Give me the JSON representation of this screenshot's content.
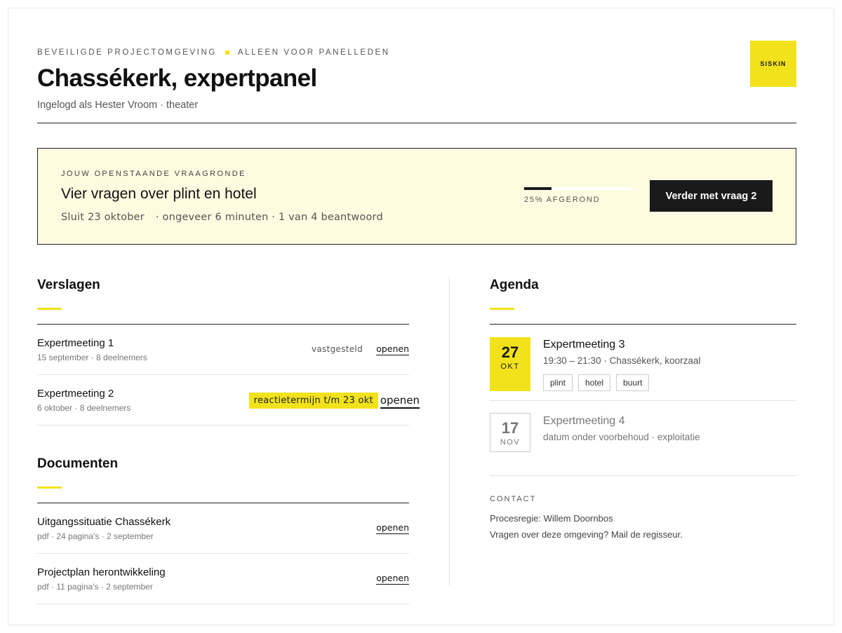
{
  "header": {
    "eyebrow_left": "BEVEILIGDE PROJECTOMGEVING",
    "eyebrow_right": "ALLEEN VOOR PANELLEDEN",
    "title": "Chassékerk, expertpanel",
    "subtitle": "Ingelogd als Hester Vroom · theater",
    "logo": "SISKIN"
  },
  "banner": {
    "label": "JOUW OPENSTAANDE VRAAGRONDE",
    "heading": "Vier vragen over plint en hotel",
    "meta_close": "Sluit 23 oktober",
    "meta_rest": "· ongeveer 6 minuten · 1 van 4 beantwoord",
    "progress_percent": 25,
    "progress_label": "25% AFGEROND",
    "cta": "Verder met vraag 2"
  },
  "verslagen": {
    "title": "Verslagen",
    "items": [
      {
        "title": "Expertmeeting 1",
        "sub": "15 september · 8 deelnemers",
        "status": "vastgesteld",
        "link": "openen"
      },
      {
        "title": "Expertmeeting 2",
        "sub": "6 oktober · 8 deelnemers",
        "status": "reactietermijn t/m 23 okt",
        "link": "openen"
      }
    ]
  },
  "documenten": {
    "title": "Documenten",
    "items": [
      {
        "title": "Uitgangssituatie Chassékerk",
        "sub": "pdf · 24 pagina's · 2 september",
        "link": "openen"
      },
      {
        "title": "Projectplan herontwikkeling",
        "sub": "pdf · 11 pagina's · 2 september",
        "link": "openen"
      }
    ]
  },
  "agenda": {
    "title": "Agenda",
    "items": [
      {
        "day": "27",
        "month": "OKT",
        "title": "Expertmeeting 3",
        "sub": "19:30 – 21:30 · Chassékerk, koorzaal",
        "tags": [
          "plint",
          "hotel",
          "buurt"
        ]
      },
      {
        "day": "17",
        "month": "NOV",
        "title": "Expertmeeting 4",
        "sub": "datum onder voorbehoud · exploitatie"
      }
    ]
  },
  "contact": {
    "label": "CONTACT",
    "line1": "Procesregie: Willem Doornbos",
    "line2": "Vragen over deze omgeving? Mail de regisseur."
  },
  "colors": {
    "accent": "#f2e21b",
    "banner_bg": "#fdfbe0",
    "dark": "#1a1a1a"
  }
}
